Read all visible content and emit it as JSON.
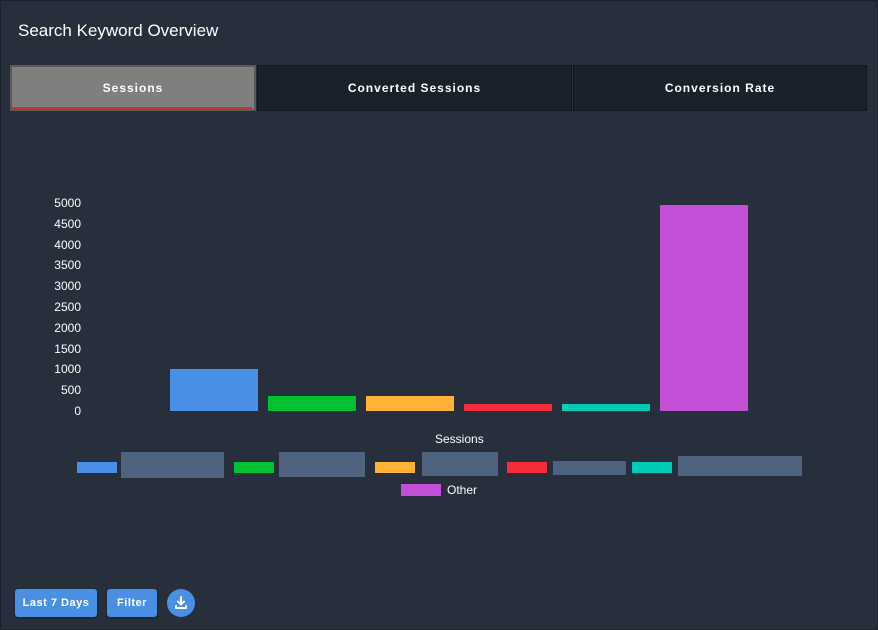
{
  "header": {
    "title": "Search Keyword Overview"
  },
  "tabs": [
    {
      "label": "Sessions",
      "active": true
    },
    {
      "label": "Converted Sessions",
      "active": false
    },
    {
      "label": "Conversion Rate",
      "active": false
    }
  ],
  "chart_data": {
    "type": "bar",
    "xlabel": "Sessions",
    "ylim": [
      0,
      5000
    ],
    "yticks": [
      "0",
      "500",
      "1000",
      "1500",
      "2000",
      "2500",
      "3000",
      "3500",
      "4000",
      "4500",
      "5000"
    ],
    "series": [
      {
        "name": "",
        "value": 1000,
        "color": "#4a8fe6"
      },
      {
        "name": "",
        "value": 360,
        "color": "#00c234"
      },
      {
        "name": "",
        "value": 360,
        "color": "#ffb233"
      },
      {
        "name": "",
        "value": 180,
        "color": "#f42d3b"
      },
      {
        "name": "",
        "value": 180,
        "color": "#00cbb6"
      },
      {
        "name": "Other",
        "value": 4950,
        "color": "#c24fd6"
      }
    ],
    "grid": false,
    "legend": "bottom"
  },
  "footer": {
    "range_label": "Last 7 Days",
    "filter_label": "Filter",
    "download_icon": "download-icon"
  }
}
